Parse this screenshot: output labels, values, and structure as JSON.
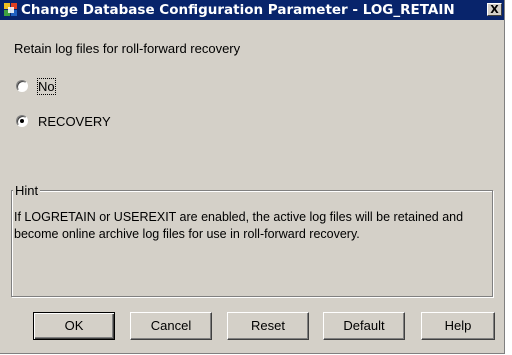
{
  "window": {
    "title": "Change Database Configuration Parameter - LOG_RETAIN",
    "close_glyph": "X",
    "title_icon": "db2-app-icon"
  },
  "parameter": {
    "prompt": "Retain log files for roll-forward recovery",
    "options": [
      {
        "label": "No",
        "selected": false
      },
      {
        "label": "RECOVERY",
        "selected": true
      }
    ]
  },
  "hint": {
    "legend": "Hint",
    "text": "If LOGRETAIN or USEREXIT are enabled, the active log files will be retained and become online archive log files for use in roll-forward recovery."
  },
  "buttons": {
    "ok": "OK",
    "cancel": "Cancel",
    "reset": "Reset",
    "default": "Default",
    "help": "Help"
  },
  "colors": {
    "title_bar": "#08246b",
    "dialog_bg": "#d4d0c8"
  }
}
